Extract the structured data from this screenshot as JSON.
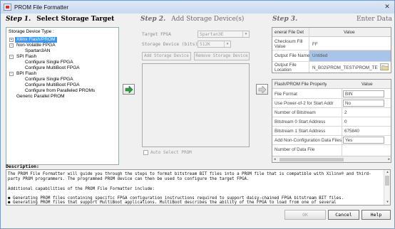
{
  "window": {
    "title": "PROM File Formatter",
    "close_glyph": "✕"
  },
  "step1": {
    "num": "Step 1.",
    "label": "Select Storage Target",
    "caption": "Storage Device Type :",
    "tree": [
      {
        "label": "Xilinx Flash/PROM",
        "sign": "+",
        "selected": true
      },
      {
        "label": "Non-Volatile FPGA",
        "sign": "-"
      },
      {
        "label": "Spartan3AN"
      },
      {
        "label": "SPI Flash",
        "sign": "-"
      },
      {
        "label": "Configure Single FPGA"
      },
      {
        "label": "Configure MultiBoot FPGA"
      },
      {
        "label": "BPI Flash",
        "sign": "-"
      },
      {
        "label": "Configure Single FPGA"
      },
      {
        "label": "Configure MultiBoot FPGA"
      },
      {
        "label": "Configure from Paralleled PROMs"
      },
      {
        "label": "Generic Parallel PROM"
      }
    ]
  },
  "step2": {
    "num": "Step 2.",
    "label": "Add Storage Device(s)",
    "target_fpga_label": "Target FPGA",
    "target_fpga_value": "Spartan3E",
    "storage_device_label": "Storage Device (bits):",
    "storage_device_value": "512K",
    "add_button": "Add Storage Device",
    "remove_button": "Remove Storage Device",
    "auto_select": "Auto Select PROM",
    "dropdown_glyph": "▼"
  },
  "step3": {
    "num": "Step 3.",
    "label": "Enter Data",
    "general_header": [
      "eneral File Det",
      "Value"
    ],
    "general_rows": [
      {
        "name": "Checksum Fill Value",
        "value": "FF"
      },
      {
        "name": "Output File Name",
        "value": "Untitled"
      },
      {
        "name": "Output File Location",
        "value": "N_B02\\PROM_TEST\\PROM_TEST\\"
      }
    ],
    "props_header": [
      "Flash/PROM File Property",
      "Value"
    ],
    "props_rows": [
      {
        "name": "File Format",
        "value": "BIN"
      },
      {
        "name": "Use Power-of-2 for Start Addr",
        "value": "No"
      },
      {
        "name": "Number of Bitstream",
        "value": "2"
      },
      {
        "name": "Bitstream 0 Start Address",
        "value": "0"
      },
      {
        "name": "Bitstream 1 Start Address",
        "value": "675840"
      },
      {
        "name": "Add Non-Configuration Data Files",
        "value": "Yes"
      },
      {
        "name": "Number of Data File",
        "value": ""
      }
    ]
  },
  "description": {
    "heading": "Description:",
    "lines": [
      "The PROM File Formatter will guide you through the steps to format bitstream BIT files into a PROM file that is compatible with Xilinx® and third-",
      "party PROM programmers. The programmed PROM device can then be used to configure the target FPGA.",
      "",
      "Additional capabilities of the PROM File Formatter include:",
      "",
      "      ● Generating PROM files containing specific FPGA configuration instructions required to support daisy-chained FPGA bitstream BIT files.",
      "      ● Generating PROM files that support MultiBoot applications. MultiBoot describes the ability of the FPGA to load from one of several"
    ]
  },
  "buttons": {
    "ok": "OK",
    "cancel": "Cancel",
    "help": "Help"
  },
  "colors": {
    "accent": "#3399ff",
    "arrow": "#2ea043"
  }
}
